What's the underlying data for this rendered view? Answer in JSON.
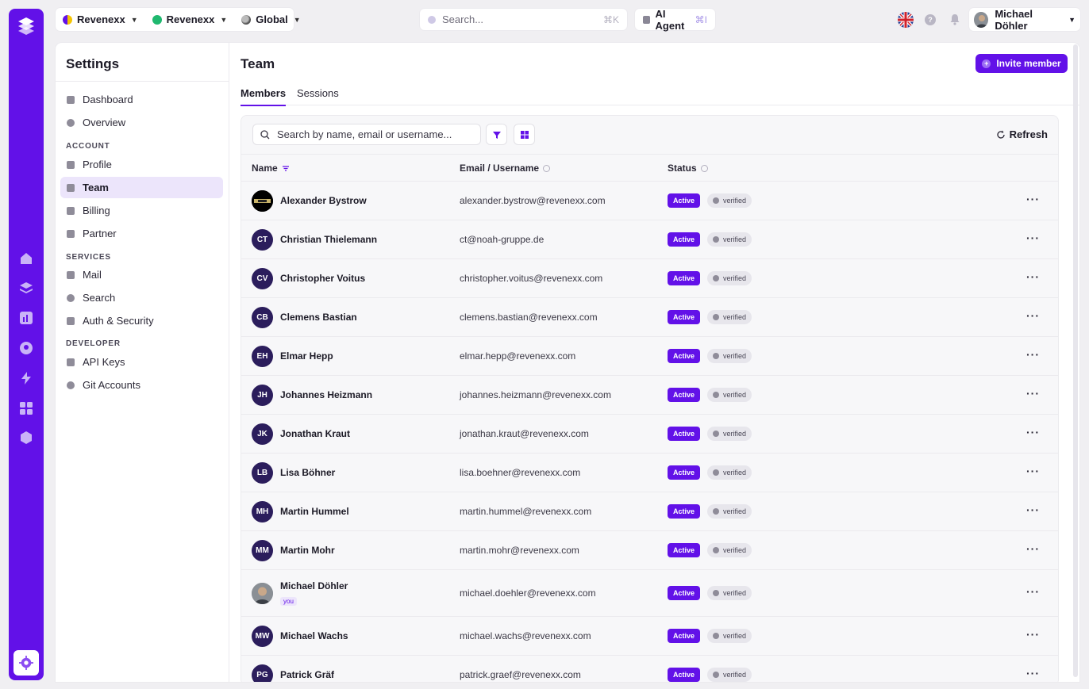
{
  "colors": {
    "brand": "#6211e8",
    "rail": "#6211e8",
    "avatar_bg": "#2b1d5c"
  },
  "topbar": {
    "workspace_a": "Revenexx",
    "workspace_b": "Revenexx",
    "scope": "Global",
    "search_placeholder": "Search...",
    "search_shortcut": "⌘K",
    "ai_agent_label": "AI Agent",
    "ai_agent_shortcut": "⌘I",
    "help_glyph": "?",
    "user_name": "Michael Döhler"
  },
  "settings": {
    "title": "Settings",
    "nav": {
      "dashboard": "Dashboard",
      "overview": "Overview",
      "section_account": "ACCOUNT",
      "profile": "Profile",
      "team": "Team",
      "billing": "Billing",
      "partner": "Partner",
      "section_services": "SERVICES",
      "mail": "Mail",
      "search": "Search",
      "auth_security": "Auth & Security",
      "section_developer": "DEVELOPER",
      "api_keys": "API Keys",
      "git_accounts": "Git Accounts"
    }
  },
  "team": {
    "title": "Team",
    "invite_label": "Invite member",
    "tabs": {
      "members": "Members",
      "sessions": "Sessions"
    },
    "search_placeholder": "Search by name, email or username...",
    "refresh_label": "Refresh",
    "columns": {
      "name": "Name",
      "email": "Email / Username",
      "status": "Status"
    },
    "you_label": "you",
    "members": [
      {
        "initials": "",
        "name": "Alexander Bystrow",
        "email": "alexander.bystrow@revenexx.com",
        "status": "Active",
        "verified": "verified"
      },
      {
        "initials": "CT",
        "name": "Christian Thielemann",
        "email": "ct@noah-gruppe.de",
        "status": "Active",
        "verified": "verified"
      },
      {
        "initials": "CV",
        "name": "Christopher Voitus",
        "email": "christopher.voitus@revenexx.com",
        "status": "Active",
        "verified": "verified"
      },
      {
        "initials": "CB",
        "name": "Clemens Bastian",
        "email": "clemens.bastian@revenexx.com",
        "status": "Active",
        "verified": "verified"
      },
      {
        "initials": "EH",
        "name": "Elmar Hepp",
        "email": "elmar.hepp@revenexx.com",
        "status": "Active",
        "verified": "verified"
      },
      {
        "initials": "JH",
        "name": "Johannes Heizmann",
        "email": "johannes.heizmann@revenexx.com",
        "status": "Active",
        "verified": "verified"
      },
      {
        "initials": "JK",
        "name": "Jonathan Kraut",
        "email": "jonathan.kraut@revenexx.com",
        "status": "Active",
        "verified": "verified"
      },
      {
        "initials": "LB",
        "name": "Lisa Böhner",
        "email": "lisa.boehner@revenexx.com",
        "status": "Active",
        "verified": "verified"
      },
      {
        "initials": "MH",
        "name": "Martin Hummel",
        "email": "martin.hummel@revenexx.com",
        "status": "Active",
        "verified": "verified"
      },
      {
        "initials": "MM",
        "name": "Martin Mohr",
        "email": "martin.mohr@revenexx.com",
        "status": "Active",
        "verified": "verified"
      },
      {
        "initials": "",
        "name": "Michael Döhler",
        "email": "michael.doehler@revenexx.com",
        "status": "Active",
        "verified": "verified"
      },
      {
        "initials": "MW",
        "name": "Michael Wachs",
        "email": "michael.wachs@revenexx.com",
        "status": "Active",
        "verified": "verified"
      },
      {
        "initials": "PG",
        "name": "Patrick Gräf",
        "email": "patrick.graef@revenexx.com",
        "status": "Active",
        "verified": "verified"
      }
    ]
  }
}
